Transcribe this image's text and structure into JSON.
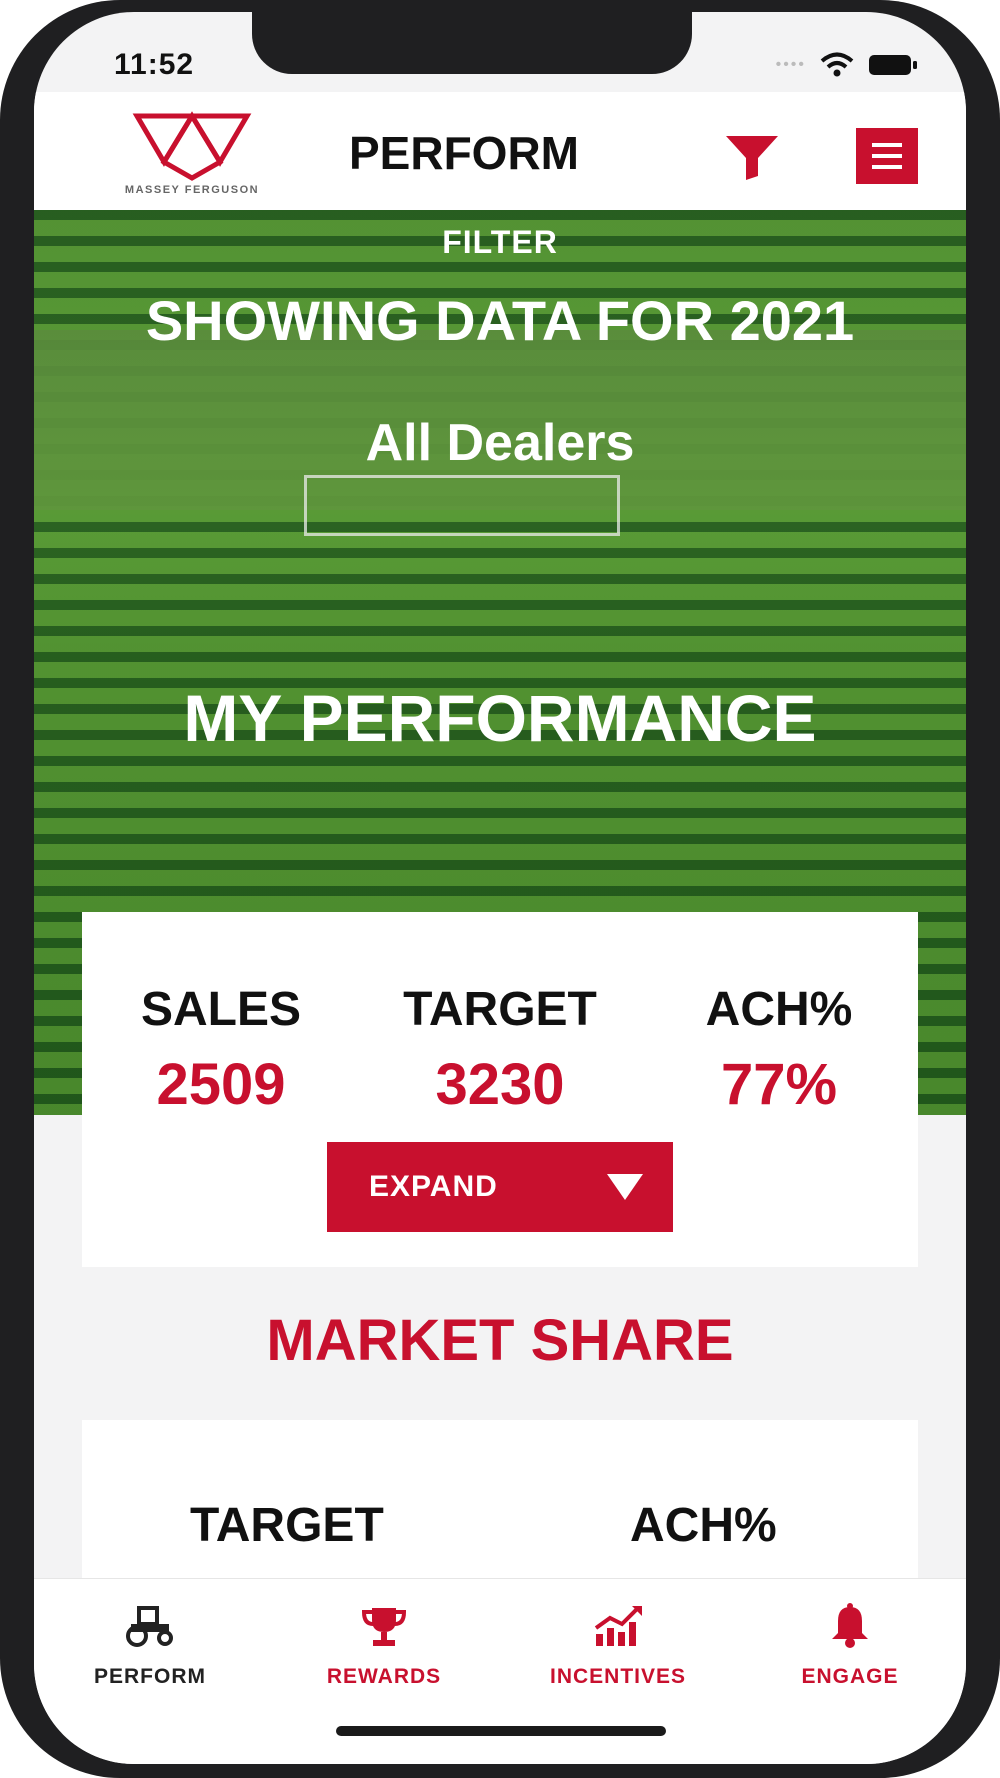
{
  "status_bar": {
    "time": "11:52"
  },
  "header": {
    "title": "PERFORM",
    "logo_text": "MASSEY FERGUSON"
  },
  "hero": {
    "filter_label": "FILTER",
    "showing": "SHOWING DATA FOR 2021",
    "dealers": "All Dealers",
    "section_title": "MY PERFORMANCE"
  },
  "stats": [
    {
      "label": "SALES",
      "value": "2509"
    },
    {
      "label": "TARGET",
      "value": "3230"
    },
    {
      "label": "ACH%",
      "value": "77%"
    }
  ],
  "expand_label": "EXPAND",
  "market_share": {
    "title": "MARKET SHARE",
    "columns": [
      "TARGET",
      "ACH%"
    ]
  },
  "tabs": [
    {
      "label": "PERFORM",
      "icon": "tractor-icon",
      "active": true
    },
    {
      "label": "REWARDS",
      "icon": "trophy-icon",
      "active": false
    },
    {
      "label": "INCENTIVES",
      "icon": "chart-up-icon",
      "active": false
    },
    {
      "label": "ENGAGE",
      "icon": "bell-icon",
      "active": false
    }
  ],
  "colors": {
    "brand": "#c8102e",
    "text": "#111111"
  }
}
